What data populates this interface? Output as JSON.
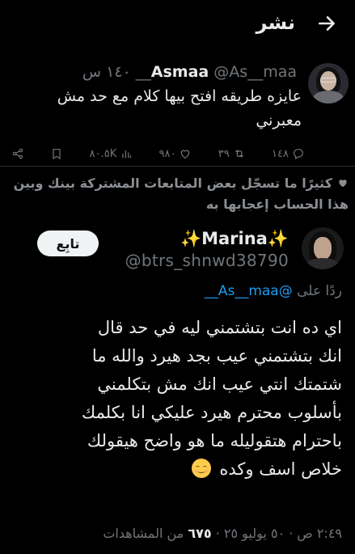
{
  "header": {
    "title": "نشر",
    "back_icon": "arrow-right-icon"
  },
  "quoted_tweet": {
    "name": "Asmaa",
    "handle": "@As__maa__",
    "time": "١٤٠ س",
    "text": "عايزه طريقه افتح بيها كلام مع حد مش معبرني",
    "actions": {
      "replies": "١٤٨",
      "retweets": "٣٩",
      "likes": "٩٨٠",
      "views": "٨٠.٥K"
    }
  },
  "like_note": "كثيرًا ما تسجّل بعض المتابعات المشتركة بينك وبين هذا الحساب إعجابها به",
  "reply": {
    "name": "Marina",
    "sparkle": "✨",
    "handle": "@btrs_shnwd38790",
    "follow_label": "تابِع",
    "replying_to_label": "ردًا على",
    "replying_to_handle": "@As__maa__",
    "text_lines": [
      "اي ده انت بتشتمني ليه في حد قال",
      "انك بتشتمني عيب بجد هيرد والله ما",
      "شتمتك انتي عيب انك مش بتكلمني",
      "بأسلوب محترم  هيرد عليكي انا بكلمك",
      "باحترام هتقوليله ما هو واضح هيقولك",
      "خلاص اسف وكده"
    ],
    "time": "٢:٤٩ ص",
    "date": "٥٠ يوليو ٢٥",
    "views_count": "٦٧٥",
    "views_label": "من المشاهدات"
  }
}
